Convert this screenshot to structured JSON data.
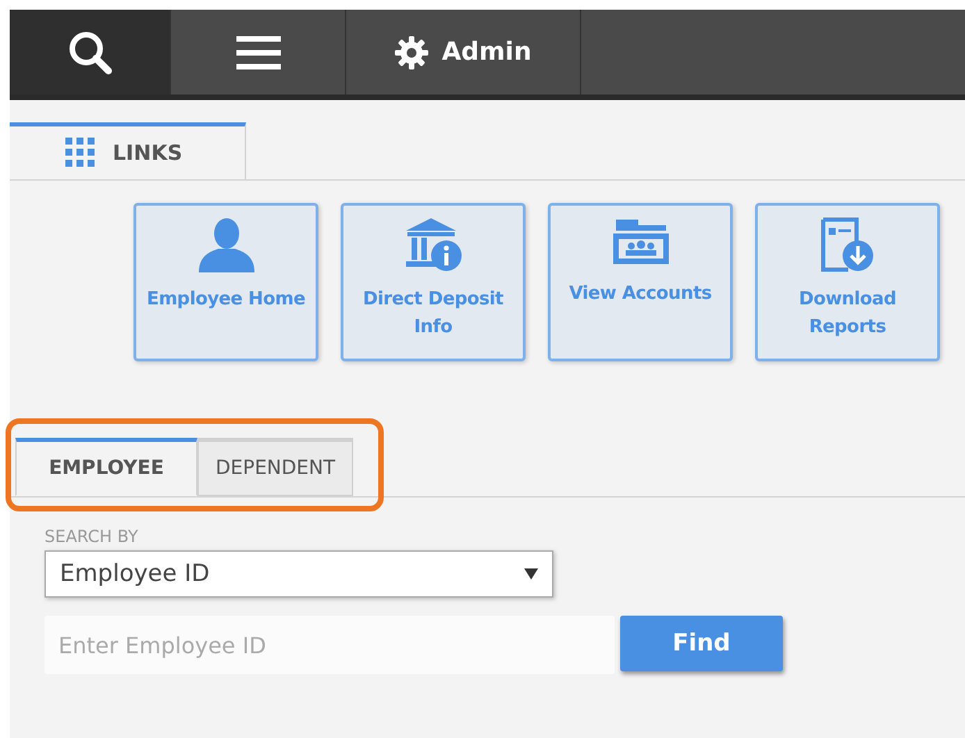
{
  "nav": [
    {
      "kind": "search",
      "selected": true
    },
    {
      "kind": "menu",
      "selected": false
    },
    {
      "kind": "admin",
      "label": "Admin",
      "selected": false
    }
  ],
  "section_tab": {
    "label": "LINKS"
  },
  "links": [
    {
      "kind": "person",
      "label": "Employee Home"
    },
    {
      "kind": "bank",
      "label": "Direct Deposit Info"
    },
    {
      "kind": "folder",
      "label": "View Accounts"
    },
    {
      "kind": "report",
      "label": "Download Reports"
    }
  ],
  "search_tabs": [
    {
      "label": "EMPLOYEE",
      "selected": true
    },
    {
      "label": "DEPENDENT",
      "selected": false
    }
  ],
  "search_by": {
    "label": "SEARCH BY",
    "value": "Employee ID"
  },
  "id_field": {
    "placeholder": "Enter Employee ID"
  },
  "find_button": {
    "label": "Find"
  }
}
